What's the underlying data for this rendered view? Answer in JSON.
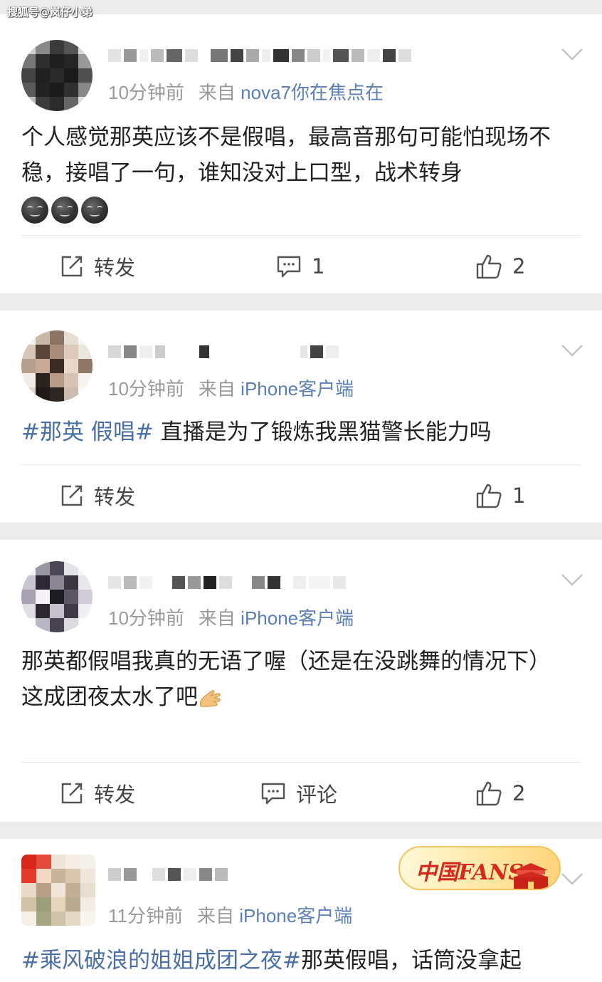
{
  "watermark": "搜狐号@岚仔小弟",
  "posts": [
    {
      "time": "10分钟前",
      "source_prefix": "来自",
      "source": "nova7你在焦点在",
      "text": "个人感觉那英应该不是假唱，最高音那句可能怕现场不稳，接唱了一句，谁知没对上口型，战术转身",
      "emoji_icon": "smirk-emoji-icon",
      "emoji_count": 3,
      "actions": {
        "repost": "转发",
        "comment": "1",
        "like": "2"
      }
    },
    {
      "time": "10分钟前",
      "source_prefix": "来自",
      "source": "iPhone客户端",
      "tag": "#那英 假唱#",
      "text": "直播是为了锻炼我黑猫警长能力吗",
      "actions": {
        "repost": "转发",
        "like": "1"
      }
    },
    {
      "time": "10分钟前",
      "source_prefix": "来自",
      "source": "iPhone客户端",
      "line1": "那英都假唱我真的无语了喔（还是在没跳舞的情况下）",
      "line2": "这成团夜太水了吧",
      "emoji_icon": "pray-hands-emoji-icon",
      "actions": {
        "repost": "转发",
        "comment": "评论",
        "like": "2"
      }
    },
    {
      "time": "11分钟前",
      "source_prefix": "来自",
      "source": "iPhone客户端",
      "badge": "中国FANS",
      "tag": "#乘风破浪的姐姐成团之夜#",
      "text": "那英假唱，话筒没拿起"
    }
  ],
  "colors": {
    "tag_blue": "#4a6fa5",
    "source_blue": "#5b7fb8",
    "meta_gray": "#9a9a9a",
    "badge_red": "#d42a1e"
  }
}
